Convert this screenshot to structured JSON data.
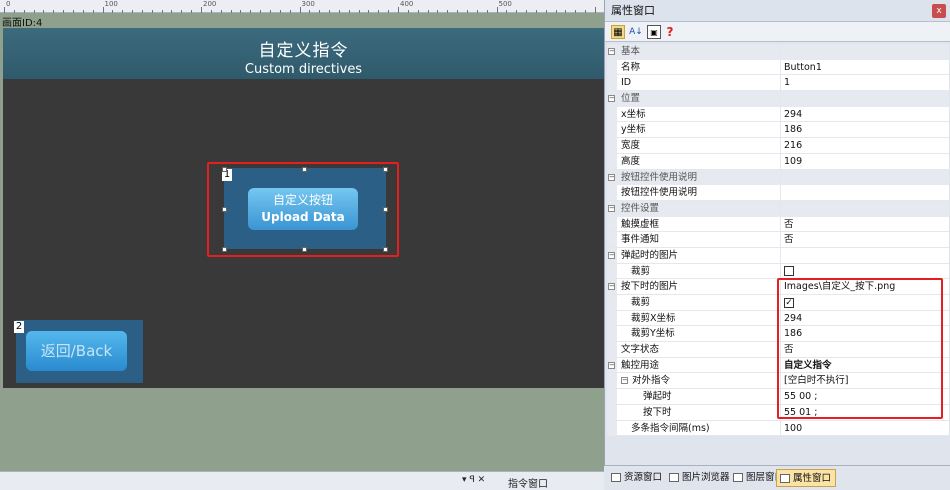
{
  "ruler": {
    "labels": [
      "0",
      "100",
      "200",
      "300",
      "400",
      "500"
    ]
  },
  "canvas": {
    "label": "画面ID:4"
  },
  "screen": {
    "title_cn": "自定义指令",
    "title_en": "Custom directives"
  },
  "button1": {
    "badge": "1",
    "label_cn": "自定义按钮",
    "label_en": "Upload Data"
  },
  "button2": {
    "badge": "2",
    "label": "返回/Back"
  },
  "bottom_bar": {
    "controls": "▾ ꟼ ✕",
    "cmd_window": "指令窗口"
  },
  "panel": {
    "title": "属性窗口",
    "close": "x",
    "toolbar": [
      {
        "icon": "categorized-icon"
      },
      {
        "icon": "sort-az-icon"
      },
      {
        "icon": "property-pages-icon"
      },
      {
        "icon": "help-icon"
      }
    ],
    "rows": [
      {
        "type": "cat",
        "key": "基本",
        "value": ""
      },
      {
        "type": "prop",
        "key": "名称",
        "value": "Button1"
      },
      {
        "type": "prop",
        "key": "ID",
        "value": "1"
      },
      {
        "type": "cat",
        "key": "位置",
        "value": ""
      },
      {
        "type": "prop",
        "key": "x坐标",
        "value": "294"
      },
      {
        "type": "prop",
        "key": "y坐标",
        "value": "186"
      },
      {
        "type": "prop",
        "key": "宽度",
        "value": "216"
      },
      {
        "type": "prop",
        "key": "高度",
        "value": "109"
      },
      {
        "type": "cat",
        "key": "按钮控件使用说明",
        "value": ""
      },
      {
        "type": "prop",
        "key": "按钮控件使用说明",
        "value": ""
      },
      {
        "type": "cat",
        "key": "控件设置",
        "value": ""
      },
      {
        "type": "prop",
        "key": "触摸虚框",
        "value": "否"
      },
      {
        "type": "prop",
        "key": "事件通知",
        "value": "否"
      },
      {
        "type": "group",
        "key": "弹起时的图片",
        "value": ""
      },
      {
        "type": "sub",
        "key": "裁剪",
        "value": "",
        "checkbox": true,
        "checked": false
      },
      {
        "type": "group",
        "key": "按下时的图片",
        "value": "Images\\自定义_按下.png"
      },
      {
        "type": "sub",
        "key": "裁剪",
        "value": "",
        "checkbox": true,
        "checked": true
      },
      {
        "type": "sub",
        "key": "裁剪X坐标",
        "value": "294"
      },
      {
        "type": "sub",
        "key": "裁剪Y坐标",
        "value": "186"
      },
      {
        "type": "prop",
        "key": "文字状态",
        "value": "否"
      },
      {
        "type": "group",
        "key": "触控用途",
        "value": "自定义指令",
        "bold": true
      },
      {
        "type": "group2",
        "key": "对外指令",
        "value": "[空白时不执行]"
      },
      {
        "type": "sub2",
        "key": "弹起时",
        "value": "55 00 ;"
      },
      {
        "type": "sub2",
        "key": "按下时",
        "value": "55 01 ;"
      },
      {
        "type": "sub",
        "key": "多条指令间隔(ms)",
        "value": "100"
      }
    ]
  },
  "tabs": [
    {
      "label": "资源窗口",
      "icon": "resource-icon"
    },
    {
      "label": "图片浏览器",
      "icon": "image-browser-icon"
    },
    {
      "label": "图层窗口",
      "icon": "layer-icon"
    },
    {
      "label": "属性窗口",
      "icon": "property-icon",
      "active": true
    }
  ]
}
